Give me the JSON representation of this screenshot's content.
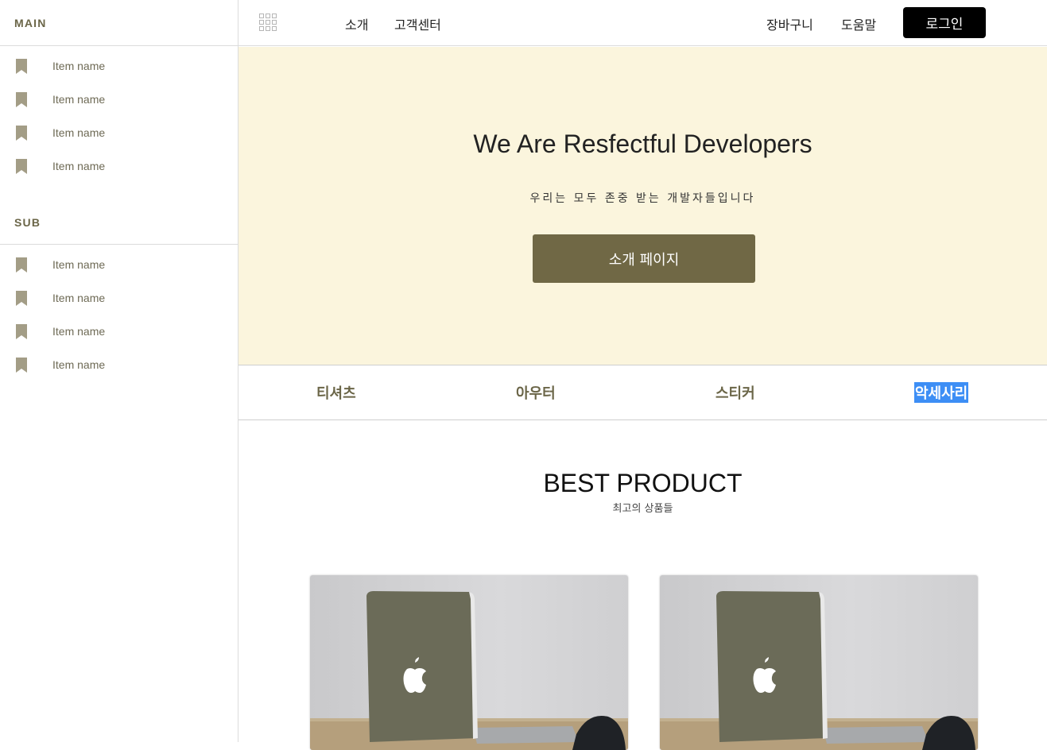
{
  "sidebar": {
    "main_heading": "MAIN",
    "main_items": [
      {
        "label": "Item name"
      },
      {
        "label": "Item name"
      },
      {
        "label": "Item name"
      },
      {
        "label": "Item name"
      }
    ],
    "sub_heading": "SUB",
    "sub_items": [
      {
        "label": "Item name"
      },
      {
        "label": "Item name"
      },
      {
        "label": "Item name"
      },
      {
        "label": "Item name"
      }
    ],
    "icon": "bookmark-icon"
  },
  "topnav": {
    "menu_icon": "grid-icon",
    "links": [
      "소개",
      "고객센터"
    ],
    "right_links": [
      "장바구니",
      "도움말"
    ],
    "login_label": "로그인"
  },
  "hero": {
    "title": "We Are Resfectful Developers",
    "subtitle": "우리는 모두 존중 받는 개발자들입니다",
    "button_label": "소개 페이지"
  },
  "categories": {
    "tabs": [
      "티셔츠",
      "아우터",
      "스티커",
      "악세사리"
    ],
    "selected": "악세사리"
  },
  "best": {
    "title": "BEST PRODUCT",
    "subtitle": "최고의 상품들"
  },
  "colors": {
    "accent": "#706845",
    "hero_bg": "#fbf5dd",
    "sidebar_text": "#6b6648",
    "selection": "#3d8ef5"
  }
}
